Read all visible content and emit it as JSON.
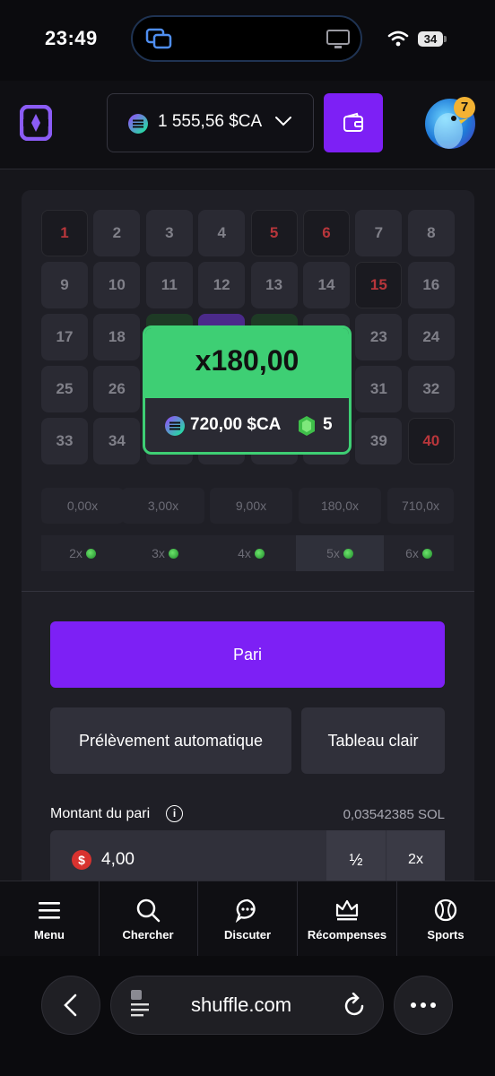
{
  "status_bar": {
    "time": "23:49",
    "battery": "34"
  },
  "header": {
    "balance": "1 555,56 $CA",
    "notification_count": "7"
  },
  "board": {
    "tiles": [
      {
        "n": "1",
        "hit": true
      },
      {
        "n": "2",
        "hit": false
      },
      {
        "n": "3",
        "hit": false
      },
      {
        "n": "4",
        "hit": false
      },
      {
        "n": "5",
        "hit": true
      },
      {
        "n": "6",
        "hit": true
      },
      {
        "n": "7",
        "hit": false
      },
      {
        "n": "8",
        "hit": false
      },
      {
        "n": "9",
        "hit": false
      },
      {
        "n": "10",
        "hit": false
      },
      {
        "n": "11",
        "hit": false
      },
      {
        "n": "12",
        "hit": false
      },
      {
        "n": "13",
        "hit": false
      },
      {
        "n": "14",
        "hit": false
      },
      {
        "n": "15",
        "hit": true
      },
      {
        "n": "16",
        "hit": false
      },
      {
        "n": "17",
        "hit": false
      },
      {
        "n": "18",
        "hit": false
      },
      {
        "n": "",
        "hit": false
      },
      {
        "n": "",
        "hit": false
      },
      {
        "n": "",
        "hit": false
      },
      {
        "n": "",
        "hit": false
      },
      {
        "n": "23",
        "hit": false
      },
      {
        "n": "24",
        "hit": false
      },
      {
        "n": "25",
        "hit": false
      },
      {
        "n": "26",
        "hit": false
      },
      {
        "n": "",
        "hit": false
      },
      {
        "n": "",
        "hit": false
      },
      {
        "n": "",
        "hit": false
      },
      {
        "n": "",
        "hit": false
      },
      {
        "n": "31",
        "hit": false
      },
      {
        "n": "32",
        "hit": false
      },
      {
        "n": "33",
        "hit": false
      },
      {
        "n": "34",
        "hit": false
      },
      {
        "n": "",
        "hit": false
      },
      {
        "n": "",
        "hit": false
      },
      {
        "n": "",
        "hit": false
      },
      {
        "n": "",
        "hit": false
      },
      {
        "n": "39",
        "hit": false
      },
      {
        "n": "40",
        "hit": true
      }
    ],
    "multipliers": [
      "0,00x",
      "3,00x",
      "9,00x",
      "180,0x",
      "710,0x"
    ],
    "hits": [
      "2x",
      "3x",
      "4x",
      "5x",
      "6x"
    ],
    "selected_hit_index": 3
  },
  "popup": {
    "multiplier": "x180,00",
    "payout": "720,00 $CA",
    "gems": "5"
  },
  "controls": {
    "bet_label": "Pari",
    "auto_pick_label": "Prélèvement automatique",
    "clear_table_label": "Tableau clair",
    "amount_label": "Montant du pari",
    "sol_value": "0,03542385 SOL",
    "amount_value": "4,00",
    "half_label": "½",
    "double_label": "2x"
  },
  "nav": {
    "items": [
      {
        "label": "Menu"
      },
      {
        "label": "Chercher"
      },
      {
        "label": "Discuter"
      },
      {
        "label": "Récompenses"
      },
      {
        "label": "Sports"
      }
    ]
  },
  "browser": {
    "url": "shuffle.com"
  },
  "colors": {
    "accent": "#7d20f5",
    "win": "#3ecf74",
    "hit": "#b8363b"
  }
}
